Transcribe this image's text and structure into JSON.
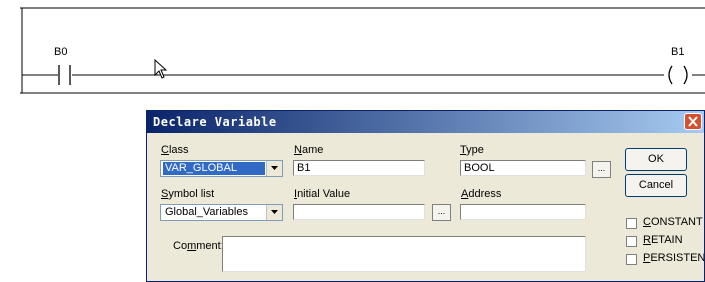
{
  "ladder": {
    "contact_label": "B0",
    "coil_label": "B1"
  },
  "dialog": {
    "title": "Declare Variable",
    "class_label_hot": "C",
    "class_label_rest": "lass",
    "class_value": "VAR_GLOBAL",
    "name_label_hot": "N",
    "name_label_rest": "ame",
    "name_value": "B1",
    "type_label_hot": "T",
    "type_label_rest": "ype",
    "type_value": "BOOL",
    "browse_label": "...",
    "symbol_list_label_hot": "S",
    "symbol_list_label_rest": "ymbol list",
    "symbol_list_value": "Global_Variables",
    "initial_value_label_hot": "I",
    "initial_value_label_rest": "nitial Value",
    "initial_value_value": "",
    "address_label_hot": "A",
    "address_label_rest": "ddress",
    "address_value": "",
    "comment_label_pre": "Co",
    "comment_label_hot": "m",
    "comment_label_rest": "ment:",
    "ok_label": "OK",
    "cancel_label": "Cancel",
    "constant_hot": "C",
    "constant_rest": "ONSTANT",
    "retain_hot": "R",
    "retain_rest": "ETAIN",
    "persistent_hot": "P",
    "persistent_rest": "ERSISTENT"
  },
  "colors": {
    "titlebar_start": "#0a246a",
    "titlebar_end": "#a6caf0",
    "selection": "#316ac5",
    "close_button": "#d4502e"
  }
}
